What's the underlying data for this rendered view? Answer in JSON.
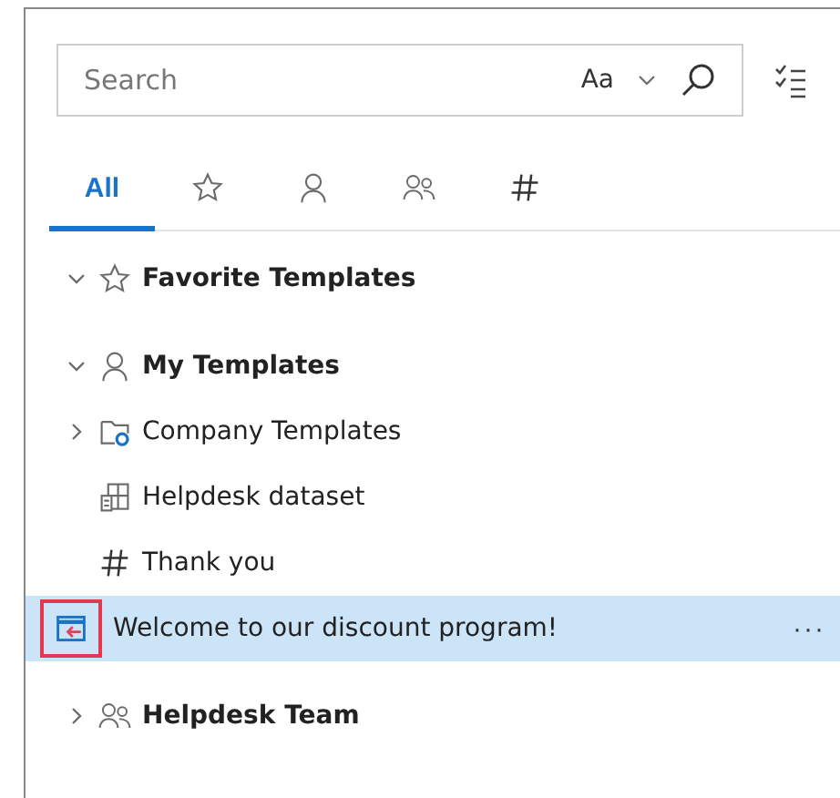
{
  "search": {
    "placeholder": "Search",
    "match_case": "Aa"
  },
  "tabs": [
    {
      "kind": "text",
      "label": "All",
      "selected": true
    },
    {
      "kind": "star",
      "selected": false
    },
    {
      "kind": "person",
      "selected": false
    },
    {
      "kind": "team",
      "selected": false
    },
    {
      "kind": "hash",
      "selected": false
    }
  ],
  "sections": [
    {
      "kind": "star",
      "label": "Favorite Templates",
      "expanded": true
    },
    {
      "kind": "person",
      "label": "My Templates",
      "expanded": true,
      "items": [
        {
          "kind": "folder",
          "label": "Company Templates",
          "expanded": false,
          "selected": false,
          "highlighted": false
        },
        {
          "kind": "dataset",
          "label": "Helpdesk dataset",
          "selected": false,
          "highlighted": false
        },
        {
          "kind": "hash",
          "label": "Thank you",
          "selected": false,
          "highlighted": false
        },
        {
          "kind": "message",
          "label": "Welcome to our discount program!",
          "selected": true,
          "highlighted": true,
          "more": "···"
        }
      ]
    },
    {
      "kind": "team",
      "label": "Helpdesk Team",
      "expanded": false
    }
  ]
}
